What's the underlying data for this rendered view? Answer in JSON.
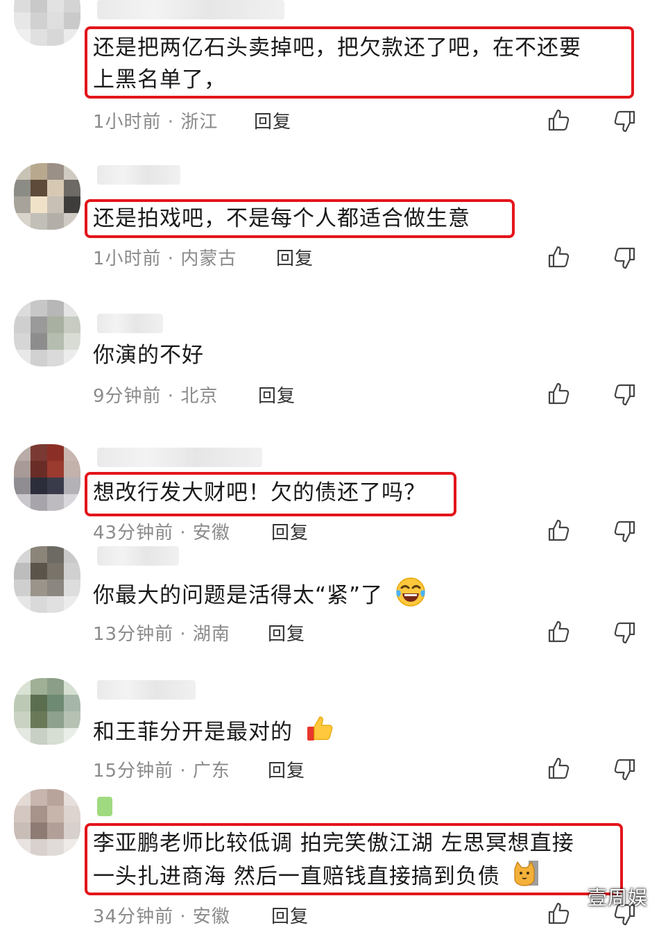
{
  "comments": [
    {
      "text_lines": [
        "还是把两亿石头卖掉吧，把欠款还了吧，在不还要",
        "上黑名单了，"
      ],
      "time": "1小时前",
      "location": "浙江",
      "reply": "回复"
    },
    {
      "text_lines": [
        "还是拍戏吧，不是每个人都适合做生意"
      ],
      "time": "1小时前",
      "location": "内蒙古",
      "reply": "回复"
    },
    {
      "text_lines": [
        "你演的不好"
      ],
      "time": "9分钟前",
      "location": "北京",
      "reply": "回复"
    },
    {
      "text_lines": [
        "想改行发大财吧！欠的债还了吗？"
      ],
      "time": "43分钟前",
      "location": "安徽",
      "reply": "回复"
    },
    {
      "text_lines": [
        "你最大的问题是活得太“紧”了"
      ],
      "emoji": "laughing-crying-emoji",
      "time": "13分钟前",
      "location": "湖南",
      "reply": "回复"
    },
    {
      "text_lines": [
        "和王菲分开是最对的"
      ],
      "emoji": "thumbs-up-emoji",
      "time": "15分钟前",
      "location": "广东",
      "reply": "回复"
    },
    {
      "text_lines": [
        "李亚鹏老师比较低调 拍完笑傲江湖 左思冥想直接",
        "一头扎进商海 然后一直赔钱直接搞到负债"
      ],
      "emoji": "cat-emoji",
      "time": "34分钟前",
      "location": "安徽",
      "reply": "回复"
    }
  ],
  "meta_separator": " · ",
  "icons": {
    "like": "thumbs-up-outline-icon",
    "dislike": "thumbs-down-outline-icon"
  },
  "colors": {
    "highlight": "#e3151a",
    "meta": "#8a8a8a"
  },
  "watermark": "壹周娱"
}
